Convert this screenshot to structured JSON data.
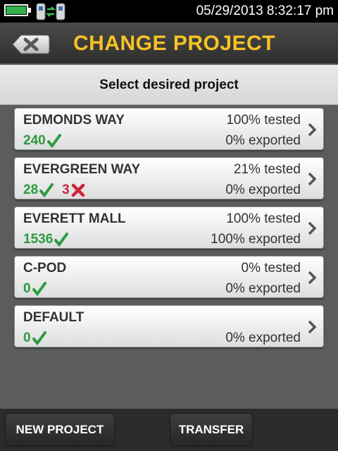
{
  "status_bar": {
    "datetime": "05/29/2013 8:32:17 pm",
    "battery_color": "#2fb34a"
  },
  "header": {
    "title": "CHANGE PROJECT",
    "back_icon": "back-x-icon",
    "title_color": "#f6c324"
  },
  "subheader": {
    "text": "Select desired project"
  },
  "projects": [
    {
      "name": "EDMONDS WAY",
      "tested": "100% tested",
      "pass": "240",
      "fail": "",
      "exported": "0% exported"
    },
    {
      "name": "EVERGREEN WAY",
      "tested": "21% tested",
      "pass": "28",
      "fail": "3",
      "exported": "0% exported"
    },
    {
      "name": "EVERETT MALL",
      "tested": "100% tested",
      "pass": "1536",
      "fail": "",
      "exported": "100% exported"
    },
    {
      "name": "C-POD",
      "tested": "0% tested",
      "pass": "0",
      "fail": "",
      "exported": "0% exported"
    },
    {
      "name": "DEFAULT",
      "tested": "",
      "pass": "0",
      "fail": "",
      "exported": "0% exported"
    }
  ],
  "colors": {
    "pass": "#2e9a3f",
    "fail": "#c8243f"
  },
  "footer": {
    "new_project": "NEW PROJECT",
    "transfer": "TRANSFER"
  }
}
